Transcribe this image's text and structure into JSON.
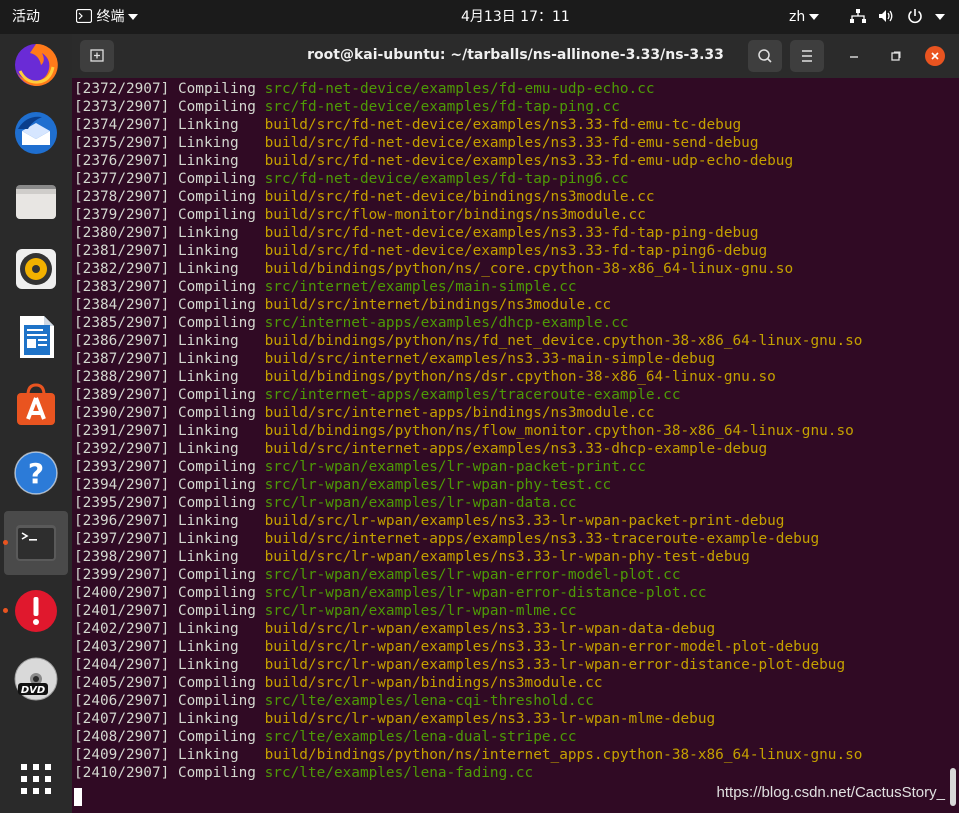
{
  "topbar": {
    "activities": "活动",
    "app_menu": "终端",
    "clock": "4月13日  17：11",
    "input_method": "zh",
    "icons": [
      "network-icon",
      "volume-icon",
      "power-icon",
      "chevron-down-icon"
    ]
  },
  "dock": {
    "apps": [
      "firefox",
      "thunderbird",
      "files",
      "rhythmbox",
      "libreoffice-writer",
      "ubuntu-software",
      "help",
      "terminal",
      "software-updater",
      "dvd",
      "show-applications"
    ]
  },
  "terminal": {
    "title": "root@kai-ubuntu: ~/tarballs/ns-allinone-3.33/ns-3.33",
    "lines": [
      {
        "num": "[2372/2907]",
        "action": "Compiling",
        "path": "src/fd-net-device/examples/fd-emu-udp-echo.cc"
      },
      {
        "num": "[2373/2907]",
        "action": "Compiling",
        "path": "src/fd-net-device/examples/fd-tap-ping.cc"
      },
      {
        "num": "[2374/2907]",
        "action": "Linking",
        "path": "build/src/fd-net-device/examples/ns3.33-fd-emu-tc-debug"
      },
      {
        "num": "[2375/2907]",
        "action": "Linking",
        "path": "build/src/fd-net-device/examples/ns3.33-fd-emu-send-debug"
      },
      {
        "num": "[2376/2907]",
        "action": "Linking",
        "path": "build/src/fd-net-device/examples/ns3.33-fd-emu-udp-echo-debug"
      },
      {
        "num": "[2377/2907]",
        "action": "Compiling",
        "path": "src/fd-net-device/examples/fd-tap-ping6.cc"
      },
      {
        "num": "[2378/2907]",
        "action": "Compiling",
        "path": "build/src/fd-net-device/bindings/ns3module.cc"
      },
      {
        "num": "[2379/2907]",
        "action": "Compiling",
        "path": "build/src/flow-monitor/bindings/ns3module.cc"
      },
      {
        "num": "[2380/2907]",
        "action": "Linking",
        "path": "build/src/fd-net-device/examples/ns3.33-fd-tap-ping-debug"
      },
      {
        "num": "[2381/2907]",
        "action": "Linking",
        "path": "build/src/fd-net-device/examples/ns3.33-fd-tap-ping6-debug"
      },
      {
        "num": "[2382/2907]",
        "action": "Linking",
        "path": "build/bindings/python/ns/_core.cpython-38-x86_64-linux-gnu.so"
      },
      {
        "num": "[2383/2907]",
        "action": "Compiling",
        "path": "src/internet/examples/main-simple.cc"
      },
      {
        "num": "[2384/2907]",
        "action": "Compiling",
        "path": "build/src/internet/bindings/ns3module.cc"
      },
      {
        "num": "[2385/2907]",
        "action": "Compiling",
        "path": "src/internet-apps/examples/dhcp-example.cc"
      },
      {
        "num": "[2386/2907]",
        "action": "Linking",
        "path": "build/bindings/python/ns/fd_net_device.cpython-38-x86_64-linux-gnu.so"
      },
      {
        "num": "[2387/2907]",
        "action": "Linking",
        "path": "build/src/internet/examples/ns3.33-main-simple-debug"
      },
      {
        "num": "[2388/2907]",
        "action": "Linking",
        "path": "build/bindings/python/ns/dsr.cpython-38-x86_64-linux-gnu.so"
      },
      {
        "num": "[2389/2907]",
        "action": "Compiling",
        "path": "src/internet-apps/examples/traceroute-example.cc"
      },
      {
        "num": "[2390/2907]",
        "action": "Compiling",
        "path": "build/src/internet-apps/bindings/ns3module.cc"
      },
      {
        "num": "[2391/2907]",
        "action": "Linking",
        "path": "build/bindings/python/ns/flow_monitor.cpython-38-x86_64-linux-gnu.so"
      },
      {
        "num": "[2392/2907]",
        "action": "Linking",
        "path": "build/src/internet-apps/examples/ns3.33-dhcp-example-debug"
      },
      {
        "num": "[2393/2907]",
        "action": "Compiling",
        "path": "src/lr-wpan/examples/lr-wpan-packet-print.cc"
      },
      {
        "num": "[2394/2907]",
        "action": "Compiling",
        "path": "src/lr-wpan/examples/lr-wpan-phy-test.cc"
      },
      {
        "num": "[2395/2907]",
        "action": "Compiling",
        "path": "src/lr-wpan/examples/lr-wpan-data.cc"
      },
      {
        "num": "[2396/2907]",
        "action": "Linking",
        "path": "build/src/lr-wpan/examples/ns3.33-lr-wpan-packet-print-debug"
      },
      {
        "num": "[2397/2907]",
        "action": "Linking",
        "path": "build/src/internet-apps/examples/ns3.33-traceroute-example-debug"
      },
      {
        "num": "[2398/2907]",
        "action": "Linking",
        "path": "build/src/lr-wpan/examples/ns3.33-lr-wpan-phy-test-debug"
      },
      {
        "num": "[2399/2907]",
        "action": "Compiling",
        "path": "src/lr-wpan/examples/lr-wpan-error-model-plot.cc"
      },
      {
        "num": "[2400/2907]",
        "action": "Compiling",
        "path": "src/lr-wpan/examples/lr-wpan-error-distance-plot.cc"
      },
      {
        "num": "[2401/2907]",
        "action": "Compiling",
        "path": "src/lr-wpan/examples/lr-wpan-mlme.cc"
      },
      {
        "num": "[2402/2907]",
        "action": "Linking",
        "path": "build/src/lr-wpan/examples/ns3.33-lr-wpan-data-debug"
      },
      {
        "num": "[2403/2907]",
        "action": "Linking",
        "path": "build/src/lr-wpan/examples/ns3.33-lr-wpan-error-model-plot-debug"
      },
      {
        "num": "[2404/2907]",
        "action": "Linking",
        "path": "build/src/lr-wpan/examples/ns3.33-lr-wpan-error-distance-plot-debug"
      },
      {
        "num": "[2405/2907]",
        "action": "Compiling",
        "path": "build/src/lr-wpan/bindings/ns3module.cc"
      },
      {
        "num": "[2406/2907]",
        "action": "Compiling",
        "path": "src/lte/examples/lena-cqi-threshold.cc"
      },
      {
        "num": "[2407/2907]",
        "action": "Linking",
        "path": "build/src/lr-wpan/examples/ns3.33-lr-wpan-mlme-debug"
      },
      {
        "num": "[2408/2907]",
        "action": "Compiling",
        "path": "src/lte/examples/lena-dual-stripe.cc"
      },
      {
        "num": "[2409/2907]",
        "action": "Linking",
        "path": "build/bindings/python/ns/internet_apps.cpython-38-x86_64-linux-gnu.so"
      },
      {
        "num": "[2410/2907]",
        "action": "Compiling",
        "path": "src/lte/examples/lena-fading.cc"
      }
    ]
  },
  "watermark": "https://blog.csdn.net/CactusStory_",
  "colors": {
    "terminal_bg": "#300a24",
    "source_path": "#4e9a06",
    "build_path": "#c4a000",
    "default_text": "#d3d7cf",
    "close_button": "#e95420"
  }
}
